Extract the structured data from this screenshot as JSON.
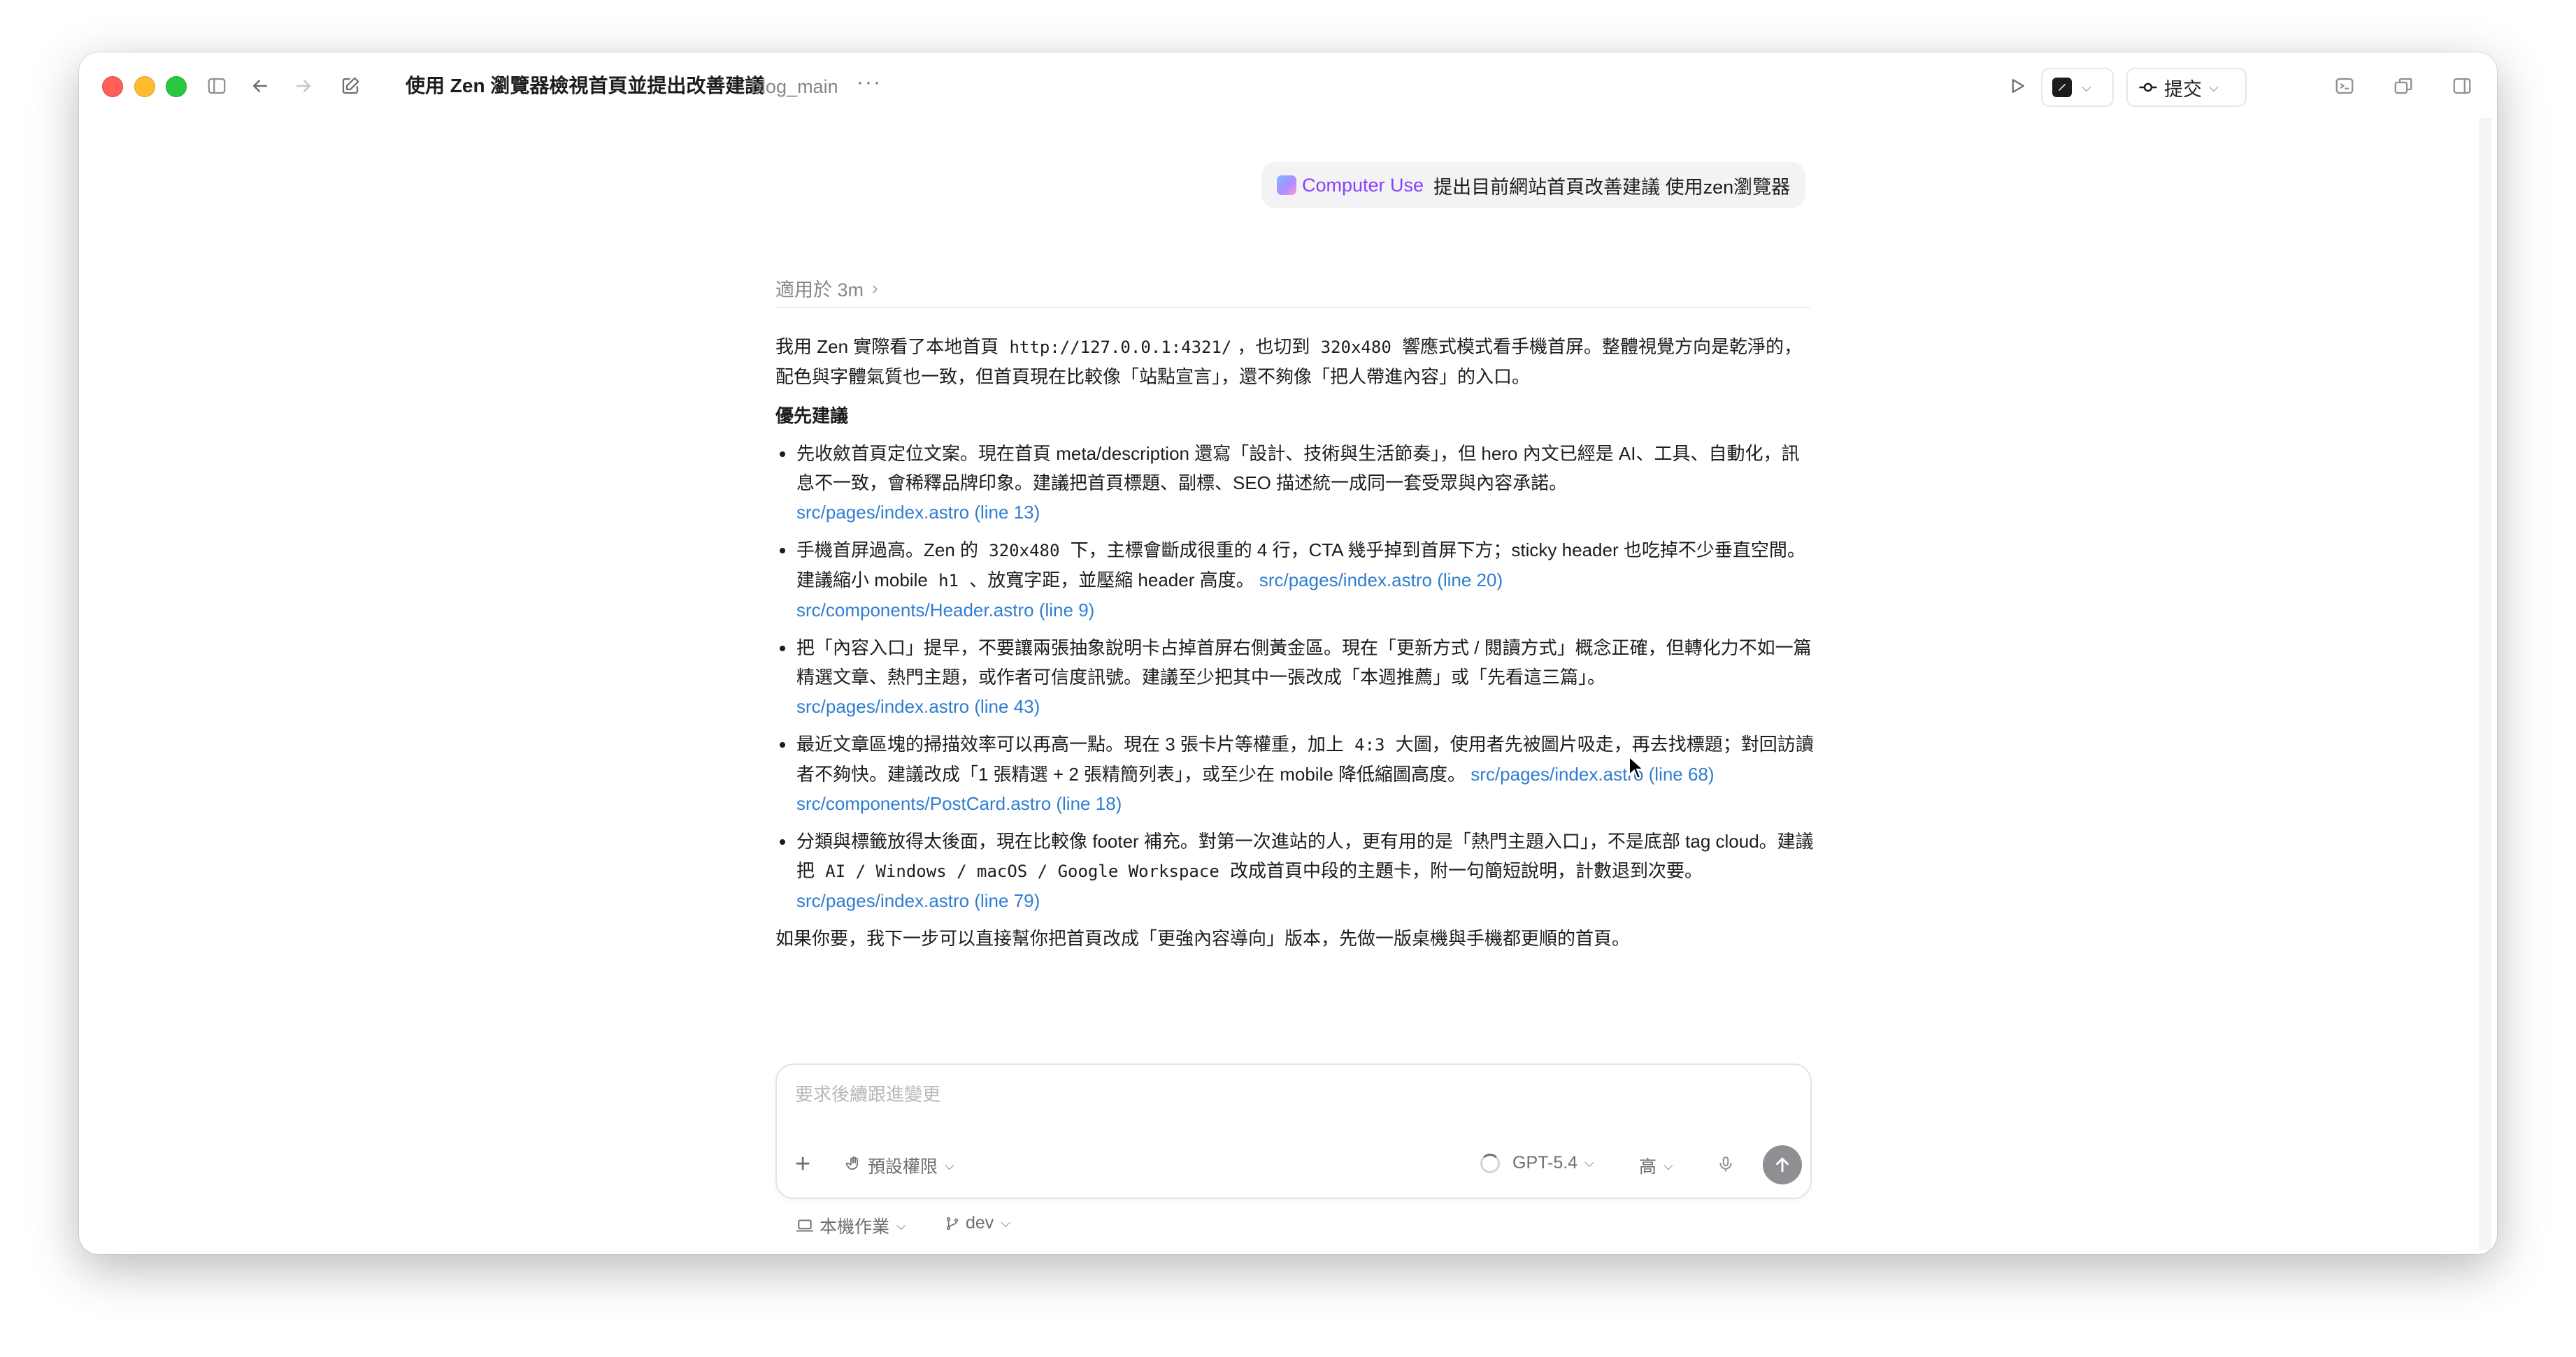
{
  "titlebar": {
    "title": "使用 Zen 瀏覽器檢視首頁並提出改善建議",
    "branch": "blog_main",
    "more": "···",
    "commit_label": "提交"
  },
  "request": {
    "tag": "Computer Use",
    "text": "提出目前網站首頁改善建議 使用zen瀏覽器"
  },
  "meta": {
    "duration": "適用於 3m"
  },
  "reply": {
    "intro_1": "我用 Zen 實際看了本地首頁",
    "intro_url": "http://127.0.0.1:4321/",
    "intro_2": "，也切到",
    "intro_size": "320x480",
    "intro_3": "響應式模式看手機首屏。整體視覺方向是乾淨的，配色與字體氣質也一致，但首頁現在比較像「站點宣言」，還不夠像「把人帶進內容」的入口。",
    "section_title": "優先建議",
    "items": [
      {
        "text": "先收斂首頁定位文案。現在首頁 meta/description 還寫「設計、技術與生活節奏」，但 hero 內文已經是 AI、工具、自動化，訊息不一致，會稀釋品牌印象。建議把首頁標題、副標、SEO 描述統一成同一套受眾與內容承諾。",
        "link1": "src/pages/index.astro (line 13)"
      },
      {
        "text_a": "手機首屏過高。Zen 的",
        "code_a": "320x480",
        "text_b": "下，主標會斷成很重的 4 行，CTA 幾乎掉到首屏下方；sticky header 也吃掉不少垂直空間。建議縮小 mobile",
        "code_b": "h1",
        "text_c": "、放寬字距，並壓縮 header 高度。",
        "link1": "src/pages/index.astro (line 20)",
        "link2": "src/components/Header.astro (line 9)"
      },
      {
        "text": "把「內容入口」提早，不要讓兩張抽象說明卡占掉首屏右側黃金區。現在「更新方式 / 閱讀方式」概念正確，但轉化力不如一篇精選文章、熱門主題，或作者可信度訊號。建議至少把其中一張改成「本週推薦」或「先看這三篇」。",
        "link1": "src/pages/index.astro (line 43)"
      },
      {
        "text_a": "最近文章區塊的掃描效率可以再高一點。現在 3 張卡片等權重，加上",
        "code_a": "4:3",
        "text_b": "大圖，使用者先被圖片吸走，再去找標題；對回訪讀者不夠快。建議改成「1 張精選 + 2 張精簡列表」，或至少在 mobile 降低縮圖高度。",
        "link1": "src/pages/index.astro (line 68)",
        "link2": "src/components/PostCard.astro (line 18)"
      },
      {
        "text_a": "分類與標籤放得太後面，現在比較像 footer 補充。對第一次進站的人，更有用的是「熱門主題入口」，不是底部 tag cloud。建議把",
        "code_a": "AI / Windows / macOS / Google Workspace",
        "text_b": "改成首頁中段的主題卡，附一句簡短說明，計數退到次要。",
        "link1": "src/pages/index.astro (line 79)"
      }
    ],
    "closing": "如果你要，我下一步可以直接幫你把首頁改成「更強內容導向」版本，先做一版桌機與手機都更順的首頁。"
  },
  "composer": {
    "placeholder": "要求後續跟進變更",
    "permissions": "預設權限",
    "model": "GPT-5.4",
    "level": "高"
  },
  "footer": {
    "workspace": "本機作業",
    "branch": "dev"
  }
}
